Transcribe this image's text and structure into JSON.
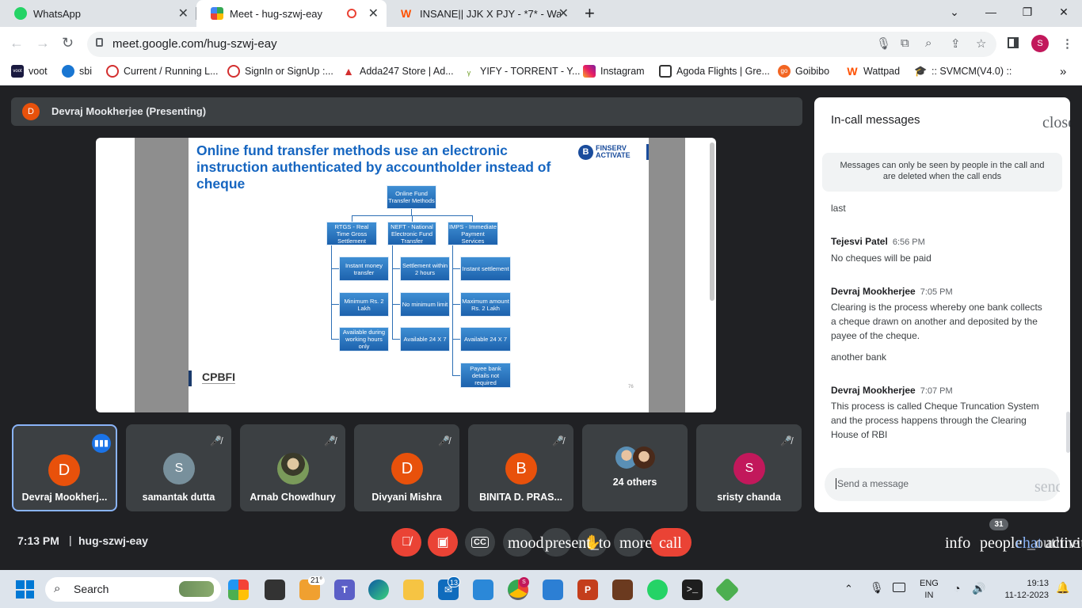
{
  "browser": {
    "tabs": [
      {
        "title": "WhatsApp",
        "close": "✕"
      },
      {
        "title": "Meet - hug-szwj-eay",
        "close": "✕"
      },
      {
        "title": "INSANE|| JJK X PJY - *7* - Wattpa",
        "close": "✕"
      }
    ],
    "new_tab": "+",
    "url": "meet.google.com/hug-szwj-eay",
    "profile_initial": "S",
    "bookmarks": [
      "voot",
      "sbi",
      "Current / Running L...",
      "SignIn or SignUp :...",
      "Adda247 Store | Ad...",
      "YIFY - TORRENT - Y...",
      "Instagram",
      "Agoda Flights | Gre...",
      "Goibibo",
      "Wattpad",
      ":: SVMCM(V4.0) ::"
    ],
    "more_bookmarks": "»"
  },
  "meet": {
    "presenter": {
      "initial": "D",
      "label": "Devraj Mookherjee (Presenting)"
    },
    "slide": {
      "title": "Online fund transfer methods use an electronic instruction authenticated by accountholder instead of cheque",
      "logo_line1": "FINSERV",
      "logo_line2": "ACTIVATE",
      "footer": "CPBFI",
      "page": "76",
      "root": "Online Fund Transfer Methods",
      "columns": [
        {
          "head": "RTGS - Real Time Gross Settlement",
          "items": [
            "Instant money transfer",
            "Minimum Rs. 2 Lakh",
            "Available during working hours only"
          ]
        },
        {
          "head": "NEFT - National Electronic Fund Transfer",
          "items": [
            "Settlement within 2 hours",
            "No minimum limit",
            "Available 24 X 7"
          ]
        },
        {
          "head": "IMPS - Immediate Payment Services",
          "items": [
            "Instant settlement",
            "Maximum amount Rs. 2 Lakh",
            "Available 24 X 7",
            "Payee bank details not required"
          ]
        }
      ]
    },
    "participants": [
      {
        "initial": "D",
        "name": "Devraj Mookherj...",
        "color": "#e8510b"
      },
      {
        "initial": "S",
        "name": "samantak dutta",
        "color": "#78909c"
      },
      {
        "initial": "",
        "name": "Arnab Chowdhury",
        "color": "#5a6b3a"
      },
      {
        "initial": "D",
        "name": "Divyani Mishra",
        "color": "#e8510b"
      },
      {
        "initial": "B",
        "name": "BINITA D. PRAS...",
        "color": "#e8510b"
      },
      {
        "initial": "",
        "name": "24 others",
        "color": "#3c4043"
      },
      {
        "initial": "S",
        "name": "sristy chanda",
        "color": "#c2185b"
      }
    ],
    "chat": {
      "title": "In-call messages",
      "close_label": "close",
      "notice": "Messages can only be seen by people in the call and are deleted when the call ends",
      "messages": [
        {
          "text": "last"
        },
        {
          "sender": "Tejesvi Patel",
          "time": "6:56 PM",
          "text": "No cheques will be paid"
        },
        {
          "sender": "Devraj Mookherjee",
          "time": "7:05 PM",
          "text": "Clearing is the process whereby one bank collects a cheque drawn on another and deposited by the payee of the cheque."
        },
        {
          "text": "another bank"
        },
        {
          "sender": "Devraj Mookherjee",
          "time": "7:07 PM",
          "text": "This process is called Cheque Truncation System and the process happens through the Clearing House of RBI"
        }
      ],
      "input_placeholder": "Send a message",
      "send_label": "send"
    },
    "bottom": {
      "clock": "7:13 PM",
      "separator": "|",
      "meeting_code": "hug-szwj-eay",
      "cc_label": "CC",
      "labels": [
        "mood",
        "present_to",
        "more",
        "call"
      ],
      "right_labels": [
        "info",
        "people",
        "chat",
        "_outline",
        "activities"
      ],
      "people_count": "31"
    }
  },
  "taskbar": {
    "search_label": "Search",
    "weather": "21°",
    "mail_badge": "13",
    "chrome_badge": "S",
    "lang1": "ENG",
    "lang2": "IN",
    "time": "19:13",
    "date": "11-12-2023"
  },
  "colors": {
    "meet_bg": "#202124",
    "tile_bg": "#3c4043",
    "red": "#ea4335",
    "active_border": "#8ab4f8"
  }
}
